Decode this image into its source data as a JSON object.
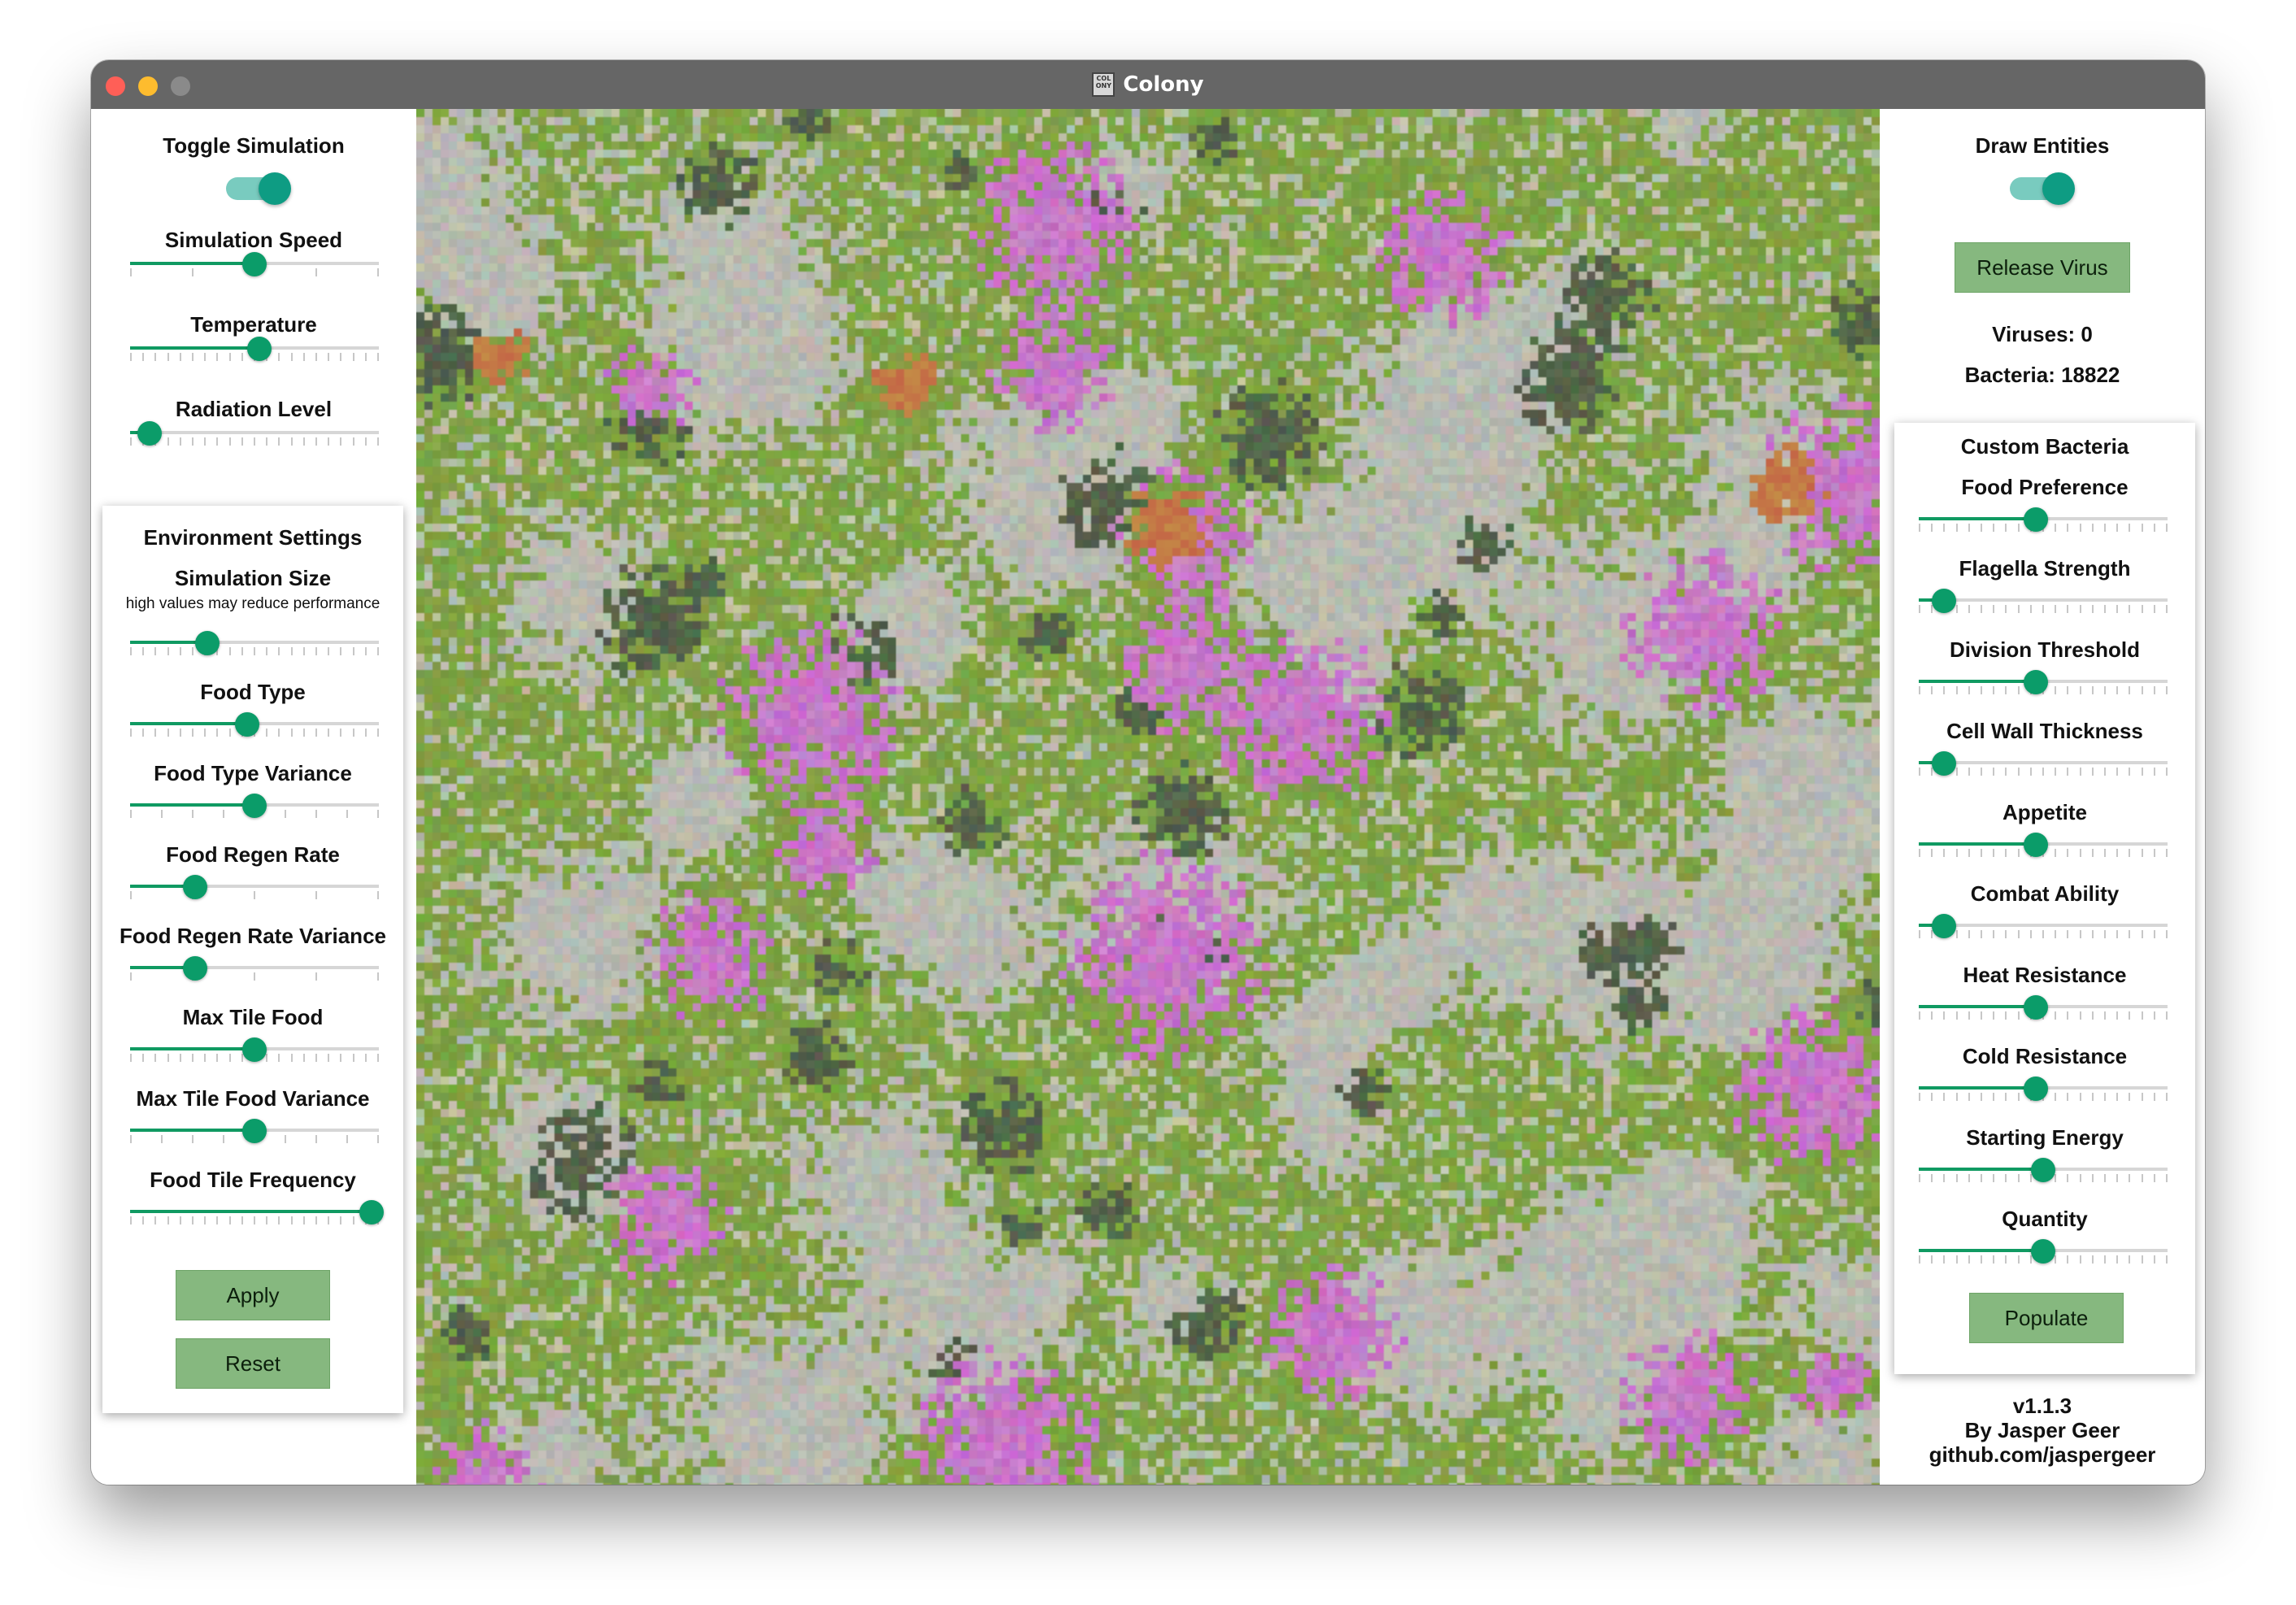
{
  "window": {
    "title": "Colony",
    "app_icon_text": "COL ONY"
  },
  "left_panel": {
    "toggle_simulation": {
      "label": "Toggle Simulation",
      "on": true
    },
    "sliders": [
      {
        "label": "Simulation Speed",
        "value": 0.5,
        "ticks": 5
      },
      {
        "label": "Temperature",
        "value": 0.52,
        "ticks": 21
      },
      {
        "label": "Radiation Level",
        "value": 0.08,
        "ticks": 21
      }
    ],
    "environment": {
      "title": "Environment Settings",
      "simulation_size": {
        "label": "Simulation Size",
        "note": "high values may reduce performance",
        "value": 0.31,
        "ticks": 21
      },
      "sliders": [
        {
          "label": "Food Type",
          "value": 0.47,
          "ticks": 21
        },
        {
          "label": "Food Type Variance",
          "value": 0.5,
          "ticks": 9
        },
        {
          "label": "Food Regen Rate",
          "value": 0.26,
          "ticks": 5
        },
        {
          "label": "Food Regen Rate Variance",
          "value": 0.26,
          "ticks": 5
        },
        {
          "label": "Max Tile Food",
          "value": 0.5,
          "ticks": 21
        },
        {
          "label": "Max Tile Food Variance",
          "value": 0.5,
          "ticks": 9
        },
        {
          "label": "Food Tile Frequency",
          "value": 0.97,
          "ticks": 21
        }
      ],
      "apply_label": "Apply",
      "reset_label": "Reset"
    }
  },
  "right_panel": {
    "draw_entities": {
      "label": "Draw Entities",
      "on": true
    },
    "release_virus_label": "Release Virus",
    "viruses_text": "Viruses: 0",
    "bacteria_text": "Bacteria: 18822",
    "custom_bacteria": {
      "title": "Custom Bacteria",
      "sliders": [
        {
          "label": "Food Preference",
          "value": 0.47,
          "ticks": 21
        },
        {
          "label": "Flagella Strength",
          "value": 0.1,
          "ticks": 21
        },
        {
          "label": "Division Threshold",
          "value": 0.47,
          "ticks": 21
        },
        {
          "label": "Cell Wall Thickness",
          "value": 0.1,
          "ticks": 21
        },
        {
          "label": "Appetite",
          "value": 0.47,
          "ticks": 21
        },
        {
          "label": "Combat Ability",
          "value": 0.1,
          "ticks": 21
        },
        {
          "label": "Heat Resistance",
          "value": 0.47,
          "ticks": 21
        },
        {
          "label": "Cold Resistance",
          "value": 0.47,
          "ticks": 21
        },
        {
          "label": "Starting Energy",
          "value": 0.5,
          "ticks": 21
        },
        {
          "label": "Quantity",
          "value": 0.5,
          "ticks": 21
        }
      ],
      "populate_label": "Populate"
    },
    "footer": {
      "version": "v1.1.3",
      "author": "By Jasper Geer",
      "link": "github.com/jaspergeer"
    }
  },
  "colors": {
    "accent": "#0b9c69",
    "button": "#86b87f",
    "toggle_track": "#79cbbf",
    "toggle_knob": "#0e9c83",
    "field_green": "#7fa04a",
    "field_gray": "#b8b8b0",
    "colony_pink": "#c067b4",
    "colony_orange": "#c8664a",
    "colony_dark": "#495a3e"
  }
}
